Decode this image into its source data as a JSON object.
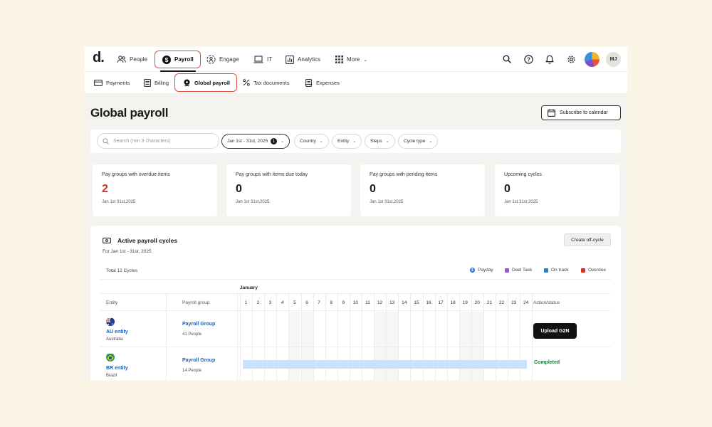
{
  "app": {
    "logo": "d.",
    "nav": [
      {
        "label": "People",
        "icon": "people-icon"
      },
      {
        "label": "Payroll",
        "icon": "dollar-circle-icon",
        "active": true
      },
      {
        "label": "Engage",
        "icon": "engage-icon"
      },
      {
        "label": "IT",
        "icon": "laptop-icon"
      },
      {
        "label": "Analytics",
        "icon": "analytics-icon"
      },
      {
        "label": "More",
        "icon": "grid-icon"
      }
    ],
    "user_initials": "MJ"
  },
  "subnav": [
    {
      "label": "Payments",
      "icon": "card-icon"
    },
    {
      "label": "Billing",
      "icon": "receipt-icon"
    },
    {
      "label": "Global payroll",
      "icon": "globe-pin-icon",
      "active": true
    },
    {
      "label": "Tax documents",
      "icon": "percent-icon"
    },
    {
      "label": "Expenses",
      "icon": "expenses-icon"
    }
  ],
  "page": {
    "title": "Global payroll",
    "subscribe_label": "Subscribe to calendar"
  },
  "filters": {
    "search_placeholder": "Search (min 3 characters)",
    "date_range": "Jan 1st - 31st, 2025",
    "date_count": "1",
    "country": "Country",
    "entity": "Entity",
    "steps": "Steps",
    "cycle_type": "Cycle type"
  },
  "stats": [
    {
      "title": "Pay groups with overdue items",
      "value": "2",
      "date": "Jan 1st 31st,2025",
      "color": "#d92d20"
    },
    {
      "title": "Pay groups with items due today",
      "value": "0",
      "date": "Jan 1st 31st,2025"
    },
    {
      "title": "Pay groups with pending items",
      "value": "0",
      "date": "Jan 1st 31st,2025"
    },
    {
      "title": "Upcoming cycles",
      "value": "0",
      "date": "Jan 1st 31st,2025"
    }
  ],
  "cycles": {
    "title": "Active payroll cycles",
    "subtitle": "For Jan 1st - 31st, 2025",
    "offcycle_label": "Create off-cycle",
    "total": "Total 12 Cycles",
    "legend": [
      {
        "label": "Payday",
        "color": "#2a6fcf"
      },
      {
        "label": "Deel Task",
        "color": "#8a5cd6"
      },
      {
        "label": "On track",
        "color": "#2a7fd4"
      },
      {
        "label": "Overdue",
        "color": "#d92d20"
      }
    ],
    "month": "January",
    "columns": {
      "entity": "Entity",
      "payroll_group": "Payroll group",
      "action": "Action/status"
    },
    "days": [
      "1",
      "2",
      "3",
      "4",
      "5",
      "6",
      "7",
      "8",
      "9",
      "10",
      "11",
      "12",
      "13",
      "14",
      "15",
      "16",
      "17",
      "18",
      "19",
      "20",
      "21",
      "22",
      "23",
      "24"
    ],
    "rows": [
      {
        "entity": "AU entity",
        "country": "Australia",
        "group": "Payroll Group",
        "people": "41 People",
        "action": "Upload G2N"
      },
      {
        "entity": "BR entity",
        "country": "Brazil",
        "group": "Payroll Group",
        "people": "14 People",
        "status": "Completed",
        "progress": 1.0
      }
    ]
  }
}
